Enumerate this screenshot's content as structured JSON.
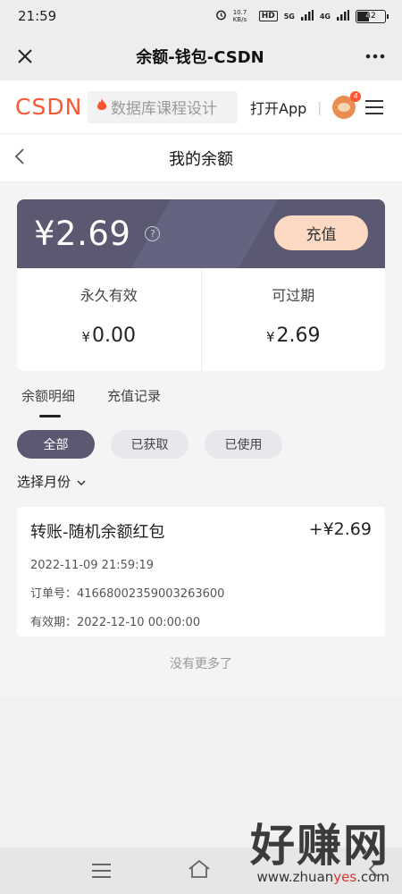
{
  "status_bar": {
    "time": "21:59",
    "net_speed": "10.7 KB/s",
    "hd": "HD",
    "signal_5g": "5G",
    "signal_4g": "4G",
    "battery": "42",
    "battery_level": 0.42
  },
  "webview": {
    "title": "余额-钱包-CSDN"
  },
  "csdn_header": {
    "logo": "CSDN",
    "search_placeholder": "数据库课程设计",
    "open_app": "打开App",
    "separator": "|",
    "avatar_badge": "4"
  },
  "sub_nav": {
    "title": "我的余额"
  },
  "balance": {
    "total": "¥2.69",
    "recharge_label": "充值",
    "permanent_label": "永久有效",
    "permanent_value": "0.00",
    "expiring_label": "可过期",
    "expiring_value": "2.69",
    "currency": "¥",
    "help": "?"
  },
  "tabs": [
    {
      "label": "余额明细",
      "active": true
    },
    {
      "label": "充值记录",
      "active": false
    }
  ],
  "filters": [
    {
      "label": "全部",
      "active": true
    },
    {
      "label": "已获取",
      "active": false
    },
    {
      "label": "已使用",
      "active": false
    }
  ],
  "month_select": {
    "label": "选择月份"
  },
  "records": [
    {
      "title": "转账-随机余额红包",
      "amount": "+¥2.69",
      "time": "2022-11-09 21:59:19",
      "order_label": "订单号：",
      "order_no": "4166800235900326360​0",
      "expiry_label": "有效期：",
      "expiry": "2022-12-10 00:00:00"
    }
  ],
  "no_more": "没有更多了",
  "watermark": {
    "main": "好赚网",
    "url_prefix": "www.zhuan",
    "url_highlight": "yes",
    "url_suffix": ".com"
  },
  "colors": {
    "brand": "#fc5531",
    "card": "#5a5971",
    "recharge": "#fbd9c2"
  }
}
